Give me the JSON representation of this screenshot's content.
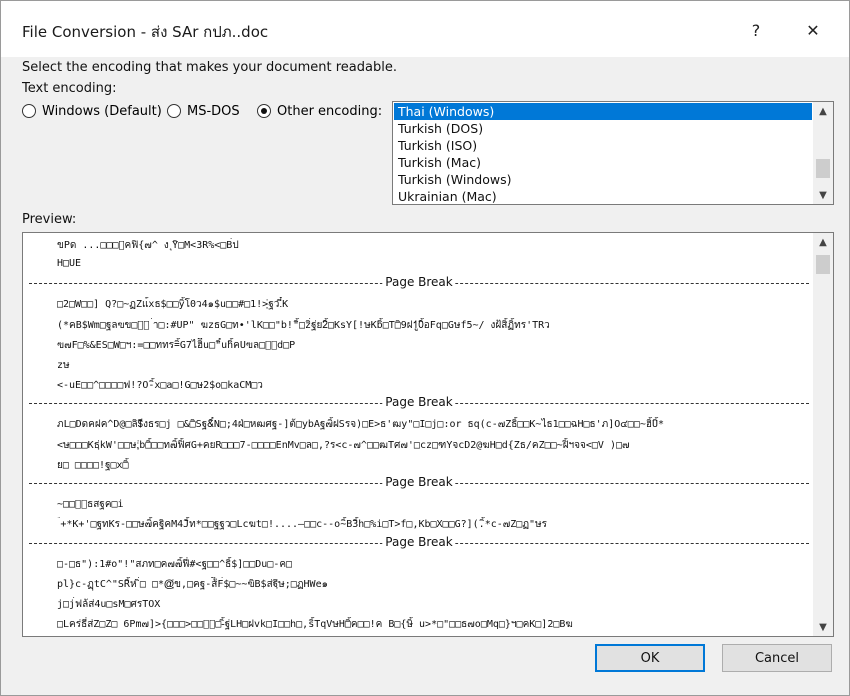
{
  "window": {
    "title": "File Conversion - ส่ง SAr กปภ..doc",
    "help_glyph": "?",
    "close_glyph": "✕"
  },
  "instructions": "Select the encoding that makes your document readable.",
  "text_encoding_label": "Text encoding:",
  "radios": [
    {
      "label": "Windows (Default)",
      "checked": false
    },
    {
      "label": "MS-DOS",
      "checked": false
    },
    {
      "label": "Other encoding:",
      "checked": true
    }
  ],
  "encoding_list": {
    "items": [
      "Thai (Windows)",
      "Turkish (DOS)",
      "Turkish (ISO)",
      "Turkish (Mac)",
      "Turkish (Windows)",
      "Ukrainian (Mac)"
    ],
    "selected_index": 0
  },
  "preview_label": "Preview:",
  "preview": {
    "page_break_label": "Page Break",
    "lines": [
      "ขPด ...□□□ัคฟิ{๗^ ง ุYิ□M<3R%<□B่ป",
      "H□UE",
      "□2□W□□]  Q?□~ฏZแ้ิxธ$□□yิ้โ0ว4๑$u□□#□1!>ฺ่ฐว.ี๋K",
      "(*คB$Wm□ฐลฃข□ิ่ ่ํา□:#UP\"         ฆzธG□ท•'lK□□\"b!\"ิ้□zิ่ฐ่ย2ิ้□KsY[!ษKbิ้□T□ิ9ฝ1ู0ิ้่อFq□Gษf5~/    งฝ้สิ้ฏิ้ทร'TRว",
      "ฃ๗F□%&ES□W□ฯ:=□□ททร=ิ้G7ไฮิีu□\"ิ์ีuhิ้ิ้คUฃล□ิ้d□P",
      "zษ",
      "<-uE□□^□□□□ฟ!?O-ิ้x□a□!G□ษ2$o□kaCM□ว",
      "ภL□Dดคฝค^D@□ลิ$ีงธร□j  □&□ิSฐ&ิ์N□;4ฝ่□หฒศฐ-]ต้□ybAฐ๗ิ้ฝSรจ)□E>ธ'ฒy\"□I□j□:or        ธq(c-๗Zธิ้□□K~ไธ1□□ฉH□ธ'ภ]O๔□□~ฮิ้Uิ้*",
      "<ษ□□□Kธฺ่kW'□□ษ;ฺ่b□ิ้□□ท๗ิ้ฟิ้ศG+คยR□□□7-□□□□EnMv□ล□,?ร<c-๗^□□ฒTศ๗'□cz□ฑYจcD2@ฆH□d{Zธ/คZ□□~ฝิ้ฯจจ<□V  )□๗",
      "ย□            □□□□!ฐ□x□ิ้",
      "~□□ิ้ธสฐค□i",
      "ิ้่ ่+*K+'□ฐทKร-□□ษ๗ิ้คฐิคM4Jิ้ท*□□ฐฐว□Lcฆt□!....—□□c--o~ิ้B3ิ้h□%i□T>f□,Kb□X□□G?](.ิ้ิ้*c-๗Z□ฏ\"ษร",
      "□-□ธ\"):1#o\"!\"สภท□ค๗๗ิ้ฟี่#<ฐ□□^ธิ้$]□□Du□-ค□",
      "pl}c-ฏฺtC^\"SRิ้ิ่ห่ ิ่□  □*@ฺ่ข,□คฐ-ส้ิ่F่ิ$□~~ฃิB$ส่ฐฺ่ิษ;□ฏHWe๑",
      "j□j่ฟล้ส่4u□sM□ศรTOX",
      "□Lคร่ธี่ส่Z□Z□              6Pm๗]>{□□□>□□ิ้□-ิ้ฐ่LH□ฝvk□I□□h□,sิ้TqVษH□ิ้ค□□!ค B□{ษิ้่ u>*□\"□□ธ๗o□Mq□}ฯ□คK□]2□Bฆ"
    ]
  },
  "buttons": {
    "ok": "OK",
    "cancel": "Cancel"
  },
  "colors": {
    "selection": "#0078d7",
    "dialog_bg": "#f0f0f0",
    "default_button_border": "#0078d7"
  }
}
